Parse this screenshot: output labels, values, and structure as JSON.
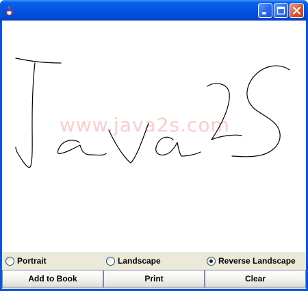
{
  "window": {
    "title": "",
    "app_icon": "java-cup-icon",
    "controls": [
      "minimize-icon",
      "maximize-icon",
      "close-icon"
    ]
  },
  "canvas": {
    "watermark": "www.java2s.com",
    "handwriting": "Java2S",
    "ink_color": "#000000"
  },
  "orientation": {
    "options": [
      {
        "label": "Portrait",
        "selected": false
      },
      {
        "label": "Landscape",
        "selected": false
      },
      {
        "label": "Reverse Landscape",
        "selected": true
      }
    ]
  },
  "buttons": {
    "add_to_book": "Add to Book",
    "print": "Print",
    "clear": "Clear"
  },
  "colors": {
    "titlebar": "#0054e3",
    "panel": "#ece9d8",
    "watermark": "#ffb0b0",
    "close_button": "#e0532e"
  }
}
